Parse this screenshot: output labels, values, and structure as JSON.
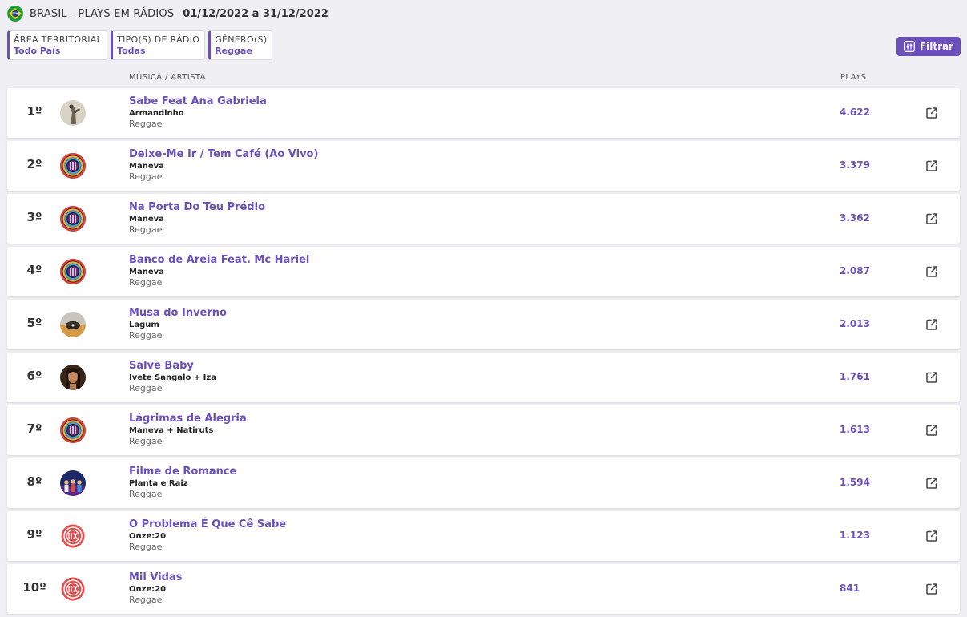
{
  "header": {
    "title": "BRASIL - PLAYS EM RÁDIOS",
    "dates": "01/12/2022 a 31/12/2022"
  },
  "filters": [
    {
      "label": "ÁREA TERRITORIAL",
      "value": "Todo País"
    },
    {
      "label": "TIPO(S) DE RÁDIO",
      "value": "Todas"
    },
    {
      "label": "GÊNERO(S)",
      "value": "Reggae"
    }
  ],
  "filter_button": {
    "label": "Filtrar",
    "icon": "sliders-icon"
  },
  "columns": {
    "music": "MÚSICA / ARTISTA",
    "plays": "PLAYS"
  },
  "colors": {
    "accent": "#6b4fbb",
    "background": "#f0eff4"
  },
  "rows": [
    {
      "rank": "1º",
      "song": "Sabe Feat Ana Gabriela",
      "artist": "Armandinho",
      "genre": "Reggae",
      "plays": "4.622",
      "avatar": "a1"
    },
    {
      "rank": "2º",
      "song": "Deixe-Me Ir / Tem Café (Ao Vivo)",
      "artist": "Maneva",
      "genre": "Reggae",
      "plays": "3.379",
      "avatar": "maneva"
    },
    {
      "rank": "3º",
      "song": "Na Porta Do Teu Prédio",
      "artist": "Maneva",
      "genre": "Reggae",
      "plays": "3.362",
      "avatar": "maneva"
    },
    {
      "rank": "4º",
      "song": "Banco de Areia Feat. Mc Hariel",
      "artist": "Maneva",
      "genre": "Reggae",
      "plays": "2.087",
      "avatar": "maneva"
    },
    {
      "rank": "5º",
      "song": "Musa do Inverno",
      "artist": "Lagum",
      "genre": "Reggae",
      "plays": "2.013",
      "avatar": "lagum"
    },
    {
      "rank": "6º",
      "song": "Salve Baby",
      "artist": "Ivete Sangalo + Iza",
      "genre": "Reggae",
      "plays": "1.761",
      "avatar": "ivete"
    },
    {
      "rank": "7º",
      "song": "Lágrimas de Alegria",
      "artist": "Maneva + Natiruts",
      "genre": "Reggae",
      "plays": "1.613",
      "avatar": "maneva"
    },
    {
      "rank": "8º",
      "song": "Filme de Romance",
      "artist": "Planta e Raiz",
      "genre": "Reggae",
      "plays": "1.594",
      "avatar": "planta"
    },
    {
      "rank": "9º",
      "song": "O Problema É Que Cê Sabe",
      "artist": "Onze:20",
      "genre": "Reggae",
      "plays": "1.123",
      "avatar": "onze"
    },
    {
      "rank": "10º",
      "song": "Mil Vidas",
      "artist": "Onze:20",
      "genre": "Reggae",
      "plays": "841",
      "avatar": "onze"
    }
  ]
}
